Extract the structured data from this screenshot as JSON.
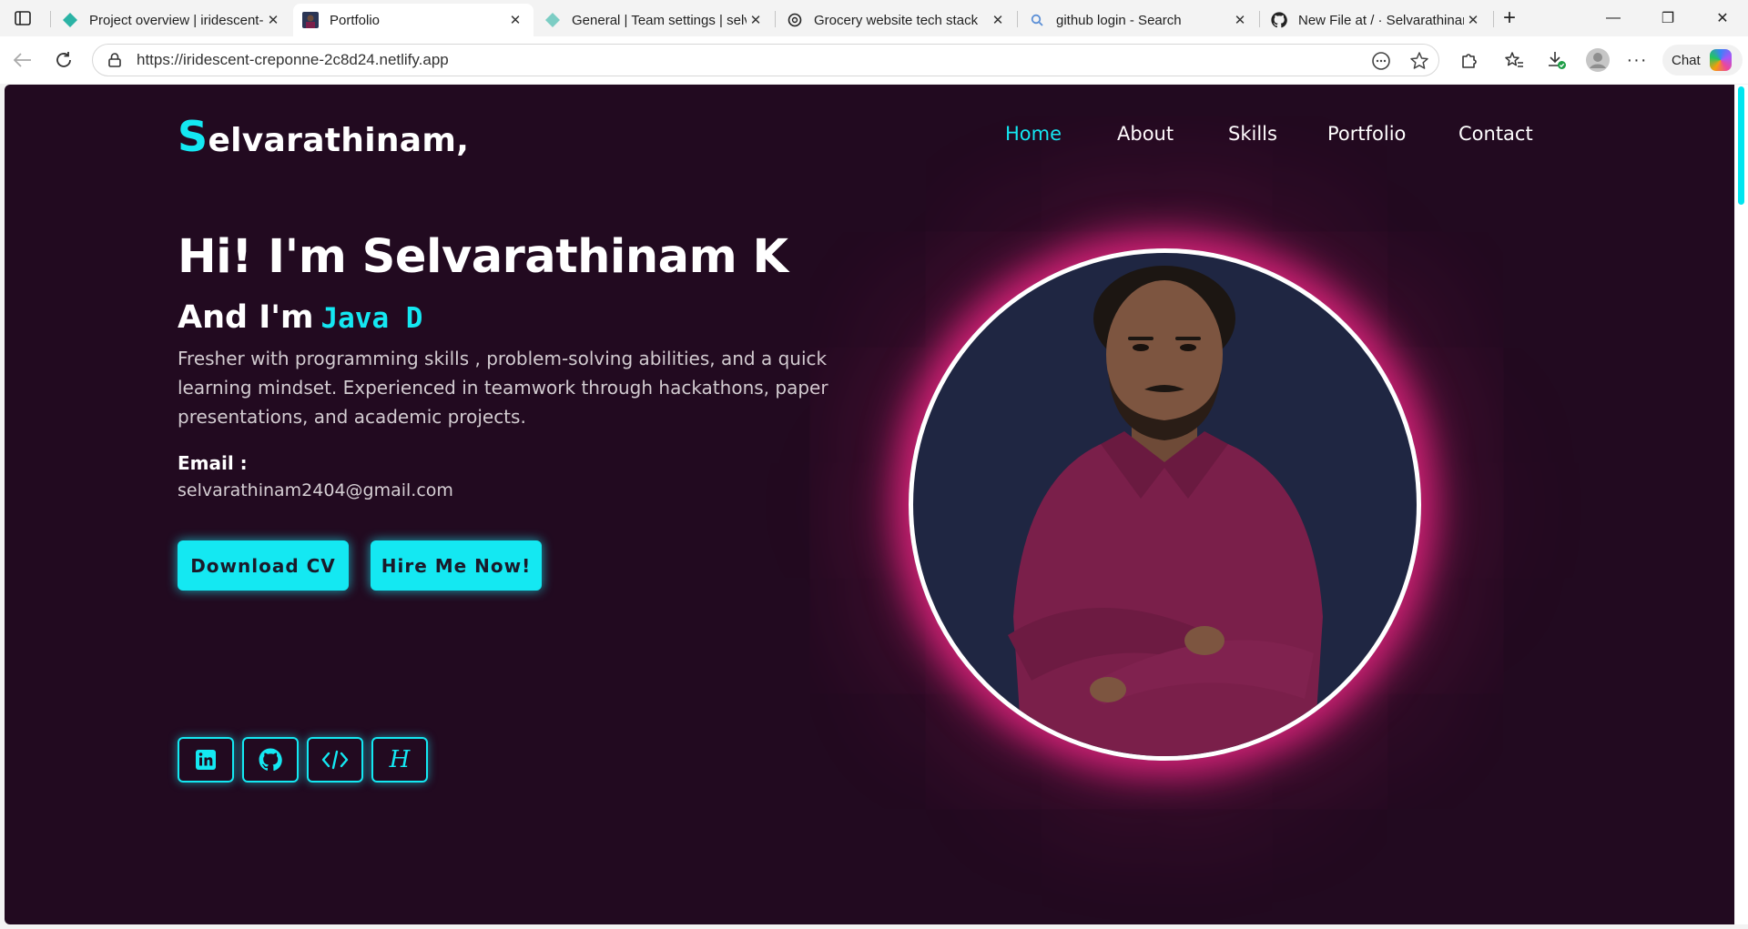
{
  "browser": {
    "tabs": [
      {
        "title": "Project overview | iridescent-",
        "favicon": "netlify-diamond-icon",
        "active": false
      },
      {
        "title": "Portfolio",
        "favicon": "portrait-favicon",
        "active": true
      },
      {
        "title": "General | Team settings | selv",
        "favicon": "netlify-diamond-icon",
        "active": false
      },
      {
        "title": "Grocery website tech stack",
        "favicon": "chatgpt-icon",
        "active": false
      },
      {
        "title": "github login - Search",
        "favicon": "search-icon",
        "active": false
      },
      {
        "title": "New File at / · Selvarathinam",
        "favicon": "github-icon",
        "active": false
      }
    ],
    "url": "https://iridescent-creponne-2c8d24.netlify.app",
    "chat_label": "Chat"
  },
  "site": {
    "logo_initial": "S",
    "logo_rest": "elvarathinam,",
    "nav": [
      {
        "label": "Home",
        "active": true
      },
      {
        "label": "About",
        "active": false
      },
      {
        "label": "Skills",
        "active": false
      },
      {
        "label": "Portfolio",
        "active": false
      },
      {
        "label": "Contact",
        "active": false
      }
    ]
  },
  "hero": {
    "title": "Hi! I'm Selvarathinam K",
    "subtitle_prefix": "And I'm",
    "typed_text": "Java D",
    "description": "Fresher with programming skills , problem-solving abilities, and a quick learning mindset. Experienced in teamwork through hackathons, paper presentations, and academic projects.",
    "email_label": "Email :",
    "email": "selvarathinam2404@gmail.com",
    "buttons": {
      "download_cv": "Download CV",
      "hire_me": "Hire Me Now!"
    },
    "social": [
      {
        "icon": "linkedin-icon"
      },
      {
        "icon": "github-icon"
      },
      {
        "icon": "code-icon"
      },
      {
        "icon": "hackerrank-icon",
        "glyph": "H"
      }
    ]
  },
  "colors": {
    "accent": "#14e8f2",
    "background": "#220a20",
    "glow": "#ff2b8c",
    "portrait_bg": "#1f2642",
    "shirt": "#7a1f4a"
  }
}
